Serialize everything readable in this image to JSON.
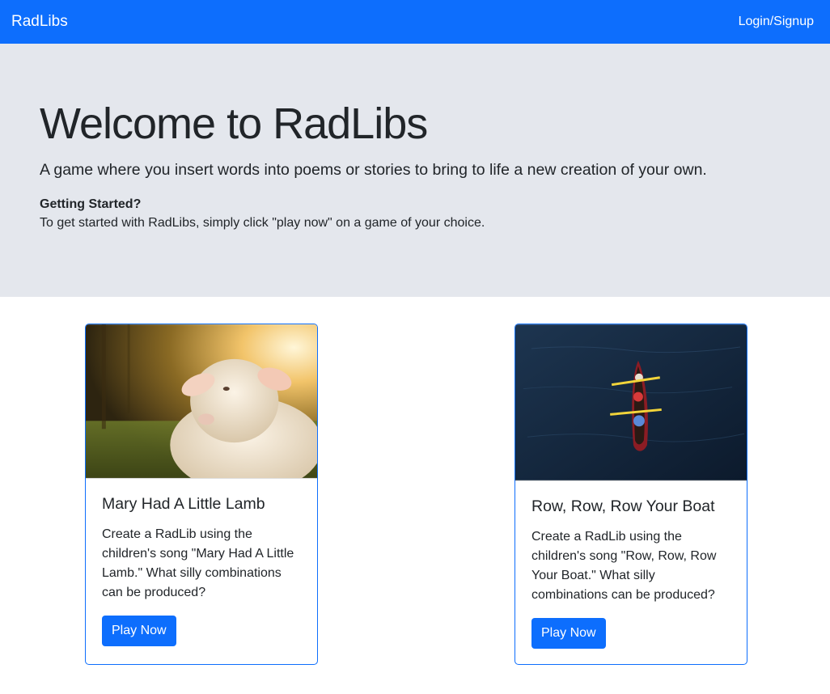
{
  "navbar": {
    "brand": "RadLibs",
    "login_label": "Login/Signup"
  },
  "hero": {
    "title": "Welcome to RadLibs",
    "lead": "A game where you insert words into poems or stories to bring to life a new creation of your own.",
    "getting_started_title": "Getting Started?",
    "getting_started_text": "To get started with RadLibs, simply click \"play now\" on a game of your choice."
  },
  "cards": [
    {
      "image": "lamb-photo",
      "title": "Mary Had A Little Lamb",
      "text": "Create a RadLib using the children's song \"Mary Had A Little Lamb.\" What silly combinations can be produced?",
      "button_label": "Play Now"
    },
    {
      "image": "canoe-photo",
      "title": "Row, Row, Row Your Boat",
      "text": "Create a RadLib using the children's song \"Row, Row, Row Your Boat.\" What silly combinations can be produced?",
      "button_label": "Play Now"
    }
  ],
  "colors": {
    "primary": "#0d6efd",
    "hero_background": "#e4e7ed"
  }
}
